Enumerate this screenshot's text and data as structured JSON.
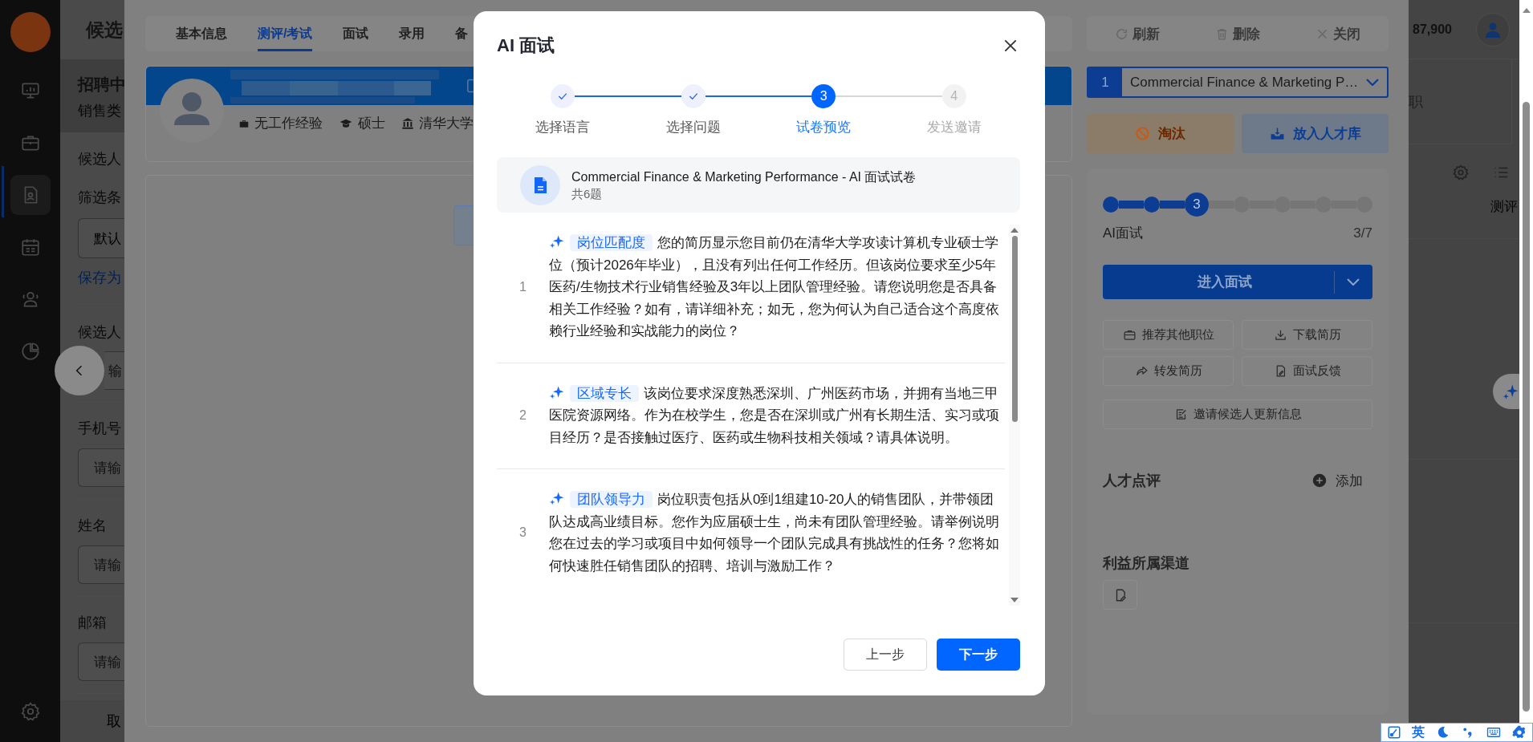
{
  "nav": {
    "items": [
      {
        "selected": false
      },
      {
        "selected": false
      },
      {
        "selected": true
      },
      {
        "selected": false
      },
      {
        "selected": false
      },
      {
        "selected": false
      }
    ]
  },
  "list_panel": {
    "title": "候选",
    "job_status": "招聘中",
    "job_category": "销售类",
    "candidate_label": "候选人",
    "filter_label": "筛选条",
    "filter_value": "默认",
    "save_link": "保存为",
    "relation_label": "候选人",
    "relation_placeholder": "输",
    "fields": [
      {
        "label": "手机号",
        "placeholder": "请输"
      },
      {
        "label": "姓名",
        "placeholder": "请输"
      },
      {
        "label": "邮箱",
        "placeholder": "请输"
      }
    ],
    "footer_button": "取"
  },
  "drawer": {
    "tabs": [
      {
        "label": "基本信息",
        "selected": false
      },
      {
        "label": "测评/考试",
        "selected": true
      },
      {
        "label": "面试",
        "selected": false
      },
      {
        "label": "录用",
        "selected": false
      },
      {
        "label": "备",
        "selected": false
      }
    ],
    "candidate": {
      "experience": "无工作经验",
      "degree": "硕士",
      "school": "清华大学"
    },
    "toolbar": [
      "刷新",
      "删除",
      "关闭"
    ],
    "job_select": {
      "index": "1",
      "value": "Commercial Finance & Marketing P…"
    },
    "actions": [
      {
        "label": "淘汰",
        "kind": "reject"
      },
      {
        "label": "放入人才库",
        "kind": "pool"
      }
    ],
    "pipeline": {
      "stages": [
        {
          "done": true,
          "current": false
        },
        {
          "done": true,
          "current": false
        },
        {
          "done": false,
          "current": true,
          "number": "3"
        },
        {
          "done": false,
          "current": false
        },
        {
          "done": false,
          "current": false
        },
        {
          "done": false,
          "current": false
        },
        {
          "done": false,
          "current": false
        }
      ],
      "stage_name": "AI面试",
      "stage_count": "3/7",
      "primary_button": "进入面试"
    },
    "tool_buttons": [
      "推荐其他职位",
      "下载简历",
      "转发简历",
      "面试反馈",
      "邀请候选人更新信息"
    ],
    "review": {
      "title": "人才点评",
      "add": "添加"
    },
    "channel": {
      "title": "利益所属渠道"
    }
  },
  "background": {
    "balance": "87,900",
    "tab_fragment": "职",
    "column_fragment": "测评"
  },
  "modal": {
    "title": "AI 面试",
    "steps": [
      {
        "label": "选择语言",
        "done": true,
        "current": false
      },
      {
        "label": "选择问题",
        "done": true,
        "current": false
      },
      {
        "label": "试卷预览",
        "done": false,
        "current": true,
        "number": "3"
      },
      {
        "label": "发送邀请",
        "done": false,
        "current": false,
        "number": "4"
      }
    ],
    "paper": {
      "title": "Commercial Finance & Marketing Performance - AI 面试试卷",
      "count": "共6题"
    },
    "questions": [
      {
        "number": "1",
        "tag": "岗位匹配度",
        "text": "您的简历显示您目前仍在清华大学攻读计算机专业硕士学位（预计2026年毕业），且没有列出任何工作经历。但该岗位要求至少5年医药/生物技术行业销售经验及3年以上团队管理经验。请您说明您是否具备相关工作经验？如有，请详细补充；如无，您为何认为自己适合这个高度依赖行业经验和实战能力的岗位？"
      },
      {
        "number": "2",
        "tag": "区域专长",
        "text": "该岗位要求深度熟悉深圳、广州医药市场，并拥有当地三甲医院资源网络。作为在校学生，您是否在深圳或广州有长期生活、实习或项目经历？是否接触过医疗、医药或生物科技相关领域？请具体说明。"
      },
      {
        "number": "3",
        "tag": "团队领导力",
        "text": "岗位职责包括从0到1组建10-20人的销售团队，并带领团队达成高业绩目标。您作为应届硕士生，尚未有团队管理经验。请举例说明您在过去的学习或项目中如何领导一个团队完成具有挑战性的任务？您将如何快速胜任销售团队的招聘、培训与激励工作？"
      }
    ],
    "buttons": [
      {
        "label": "上一步",
        "kind": "secondary"
      },
      {
        "label": "下一步",
        "kind": "primary"
      }
    ]
  },
  "ime_toolbar": {
    "language": "英"
  }
}
